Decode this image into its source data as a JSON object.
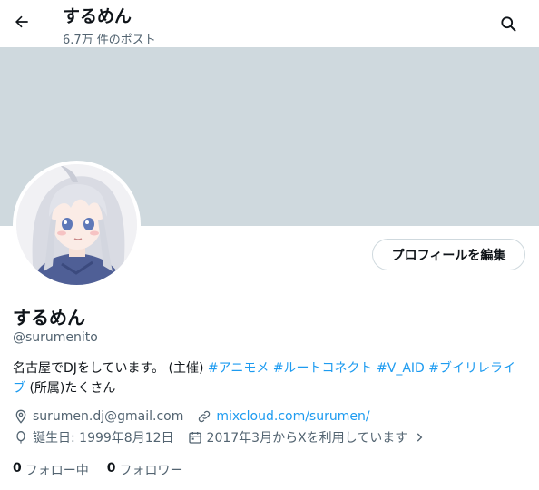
{
  "header": {
    "name": "するめん",
    "post_count": "6.7万 件のポスト"
  },
  "profile": {
    "display_name": "するめん",
    "handle": "@surumenito",
    "edit_button": "プロフィールを編集",
    "bio": {
      "text1": "名古屋でDJをしています。 (主催) ",
      "tags": [
        "#アニモメ",
        "#ルートコネクト",
        "#V_AID",
        "#ブイリレライブ"
      ],
      "text2": " (所属)たくさん"
    },
    "email": "surumen.dj@gmail.com",
    "website": "mixcloud.com/surumen/",
    "birthday": "誕生日: 1999年8月12日",
    "joined": "2017年3月からXを利用しています",
    "following_count": "0",
    "following_label": "フォロー中",
    "followers_count": "0",
    "followers_label": "フォロワー"
  },
  "colors": {
    "banner": "#cfd9de",
    "link": "#1d9bf0",
    "secondary_text": "#536471"
  }
}
